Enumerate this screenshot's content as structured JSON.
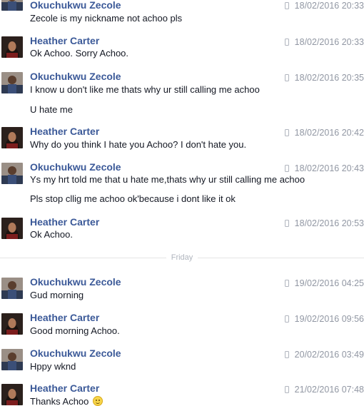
{
  "messages": [
    {
      "sender": "Okuchukwu Zecole",
      "avatar": "avatar-male",
      "time": "18/02/2016 20:33",
      "lines": [
        "Zecole is my nickname not achoo pls"
      ]
    },
    {
      "sender": "Heather Carter",
      "avatar": "avatar-female",
      "time": "18/02/2016 20:33",
      "lines": [
        "Ok Achoo. Sorry Achoo."
      ]
    },
    {
      "sender": "Okuchukwu Zecole",
      "avatar": "avatar-male",
      "time": "18/02/2016 20:35",
      "lines": [
        "I know u don't like me thats why ur still calling me achoo",
        "U hate me"
      ]
    },
    {
      "sender": "Heather Carter",
      "avatar": "avatar-female",
      "time": "18/02/2016 20:42",
      "lines": [
        "Why do you think I hate you Achoo? I don't hate you."
      ]
    },
    {
      "sender": "Okuchukwu Zecole",
      "avatar": "avatar-male",
      "time": "18/02/2016 20:43",
      "lines": [
        "Ys my hrt told me that u hate me,thats why ur still calling me achoo",
        "Pls stop cllig me achoo ok'because i dont like it ok"
      ]
    },
    {
      "sender": "Heather Carter",
      "avatar": "avatar-female",
      "time": "18/02/2016 20:53",
      "lines": [
        "Ok Achoo."
      ]
    },
    {
      "sender": "Okuchukwu Zecole",
      "avatar": "avatar-male",
      "time": "19/02/2016 04:25",
      "lines": [
        "Gud morning"
      ]
    },
    {
      "sender": "Heather Carter",
      "avatar": "avatar-female",
      "time": "19/02/2016 09:56",
      "lines": [
        "Good morning Achoo."
      ]
    },
    {
      "sender": "Okuchukwu Zecole",
      "avatar": "avatar-male",
      "time": "20/02/2016 03:49",
      "lines": [
        "Hppy wknd"
      ]
    },
    {
      "sender": "Heather Carter",
      "avatar": "avatar-female",
      "time": "21/02/2016 07:48",
      "lines": [
        "Thanks Achoo"
      ],
      "emoji": "smiley-icon"
    }
  ],
  "day_divider": "Friday",
  "colors": {
    "name": "#3b5998",
    "timestamp": "#9197a3",
    "text": "#141823",
    "divider": "#e5e5e5"
  }
}
